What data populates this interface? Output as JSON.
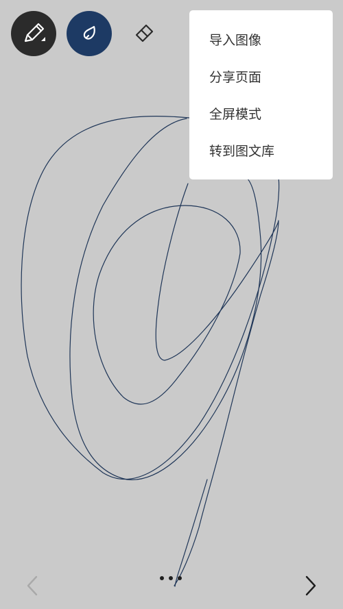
{
  "toolbar": {
    "pen_icon": "pen-icon",
    "ink_icon": "ink-drop-icon",
    "eraser_icon": "eraser-icon",
    "pen_bg": "#2b2b2b",
    "ink_bg": "#1d3a64"
  },
  "menu": {
    "items": [
      {
        "label": "导入图像"
      },
      {
        "label": "分享页面"
      },
      {
        "label": "全屏模式"
      },
      {
        "label": "转到图文库"
      }
    ]
  },
  "canvas": {
    "background": "#cacaca",
    "stroke_color": "#1e3557"
  },
  "footer": {
    "prev_icon": "chevron-left-icon",
    "next_icon": "chevron-right-icon",
    "more_icon": "more-dots-icon"
  }
}
